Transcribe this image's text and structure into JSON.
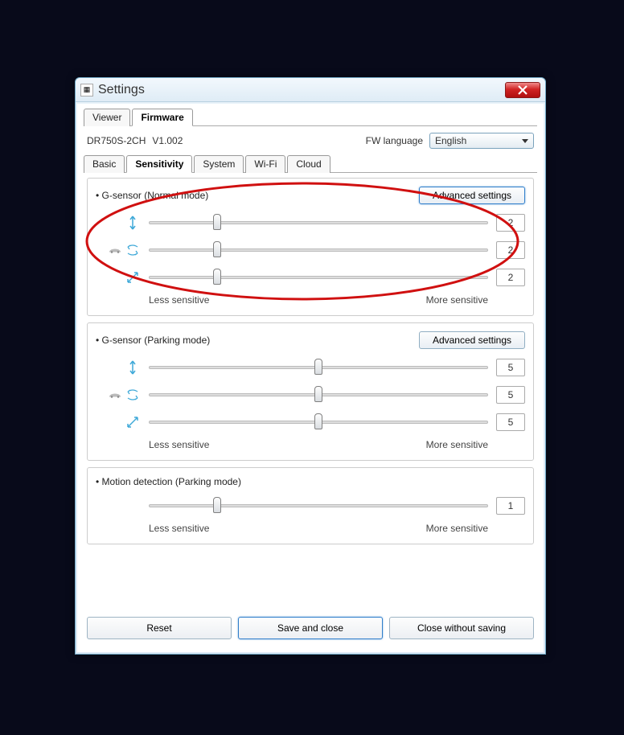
{
  "window": {
    "title": "Settings"
  },
  "top_tabs": {
    "viewer": "Viewer",
    "firmware": "Firmware"
  },
  "fw": {
    "model": "DR750S-2CH",
    "version": "V1.002",
    "lang_label": "FW language",
    "lang_value": "English"
  },
  "sub_tabs": {
    "basic": "Basic",
    "sensitivity": "Sensitivity",
    "system": "System",
    "wifi": "Wi-Fi",
    "cloud": "Cloud"
  },
  "labels": {
    "less": "Less sensitive",
    "more": "More sensitive",
    "adv": "Advanced settings"
  },
  "group1": {
    "title": "• G-sensor (Normal mode)",
    "v1": "2",
    "v2": "2",
    "v3": "2"
  },
  "group2": {
    "title": "• G-sensor (Parking mode)",
    "v1": "5",
    "v2": "5",
    "v3": "5"
  },
  "group3": {
    "title": "• Motion detection (Parking mode)",
    "v1": "1"
  },
  "footer": {
    "reset": "Reset",
    "save": "Save and close",
    "close": "Close without saving"
  }
}
